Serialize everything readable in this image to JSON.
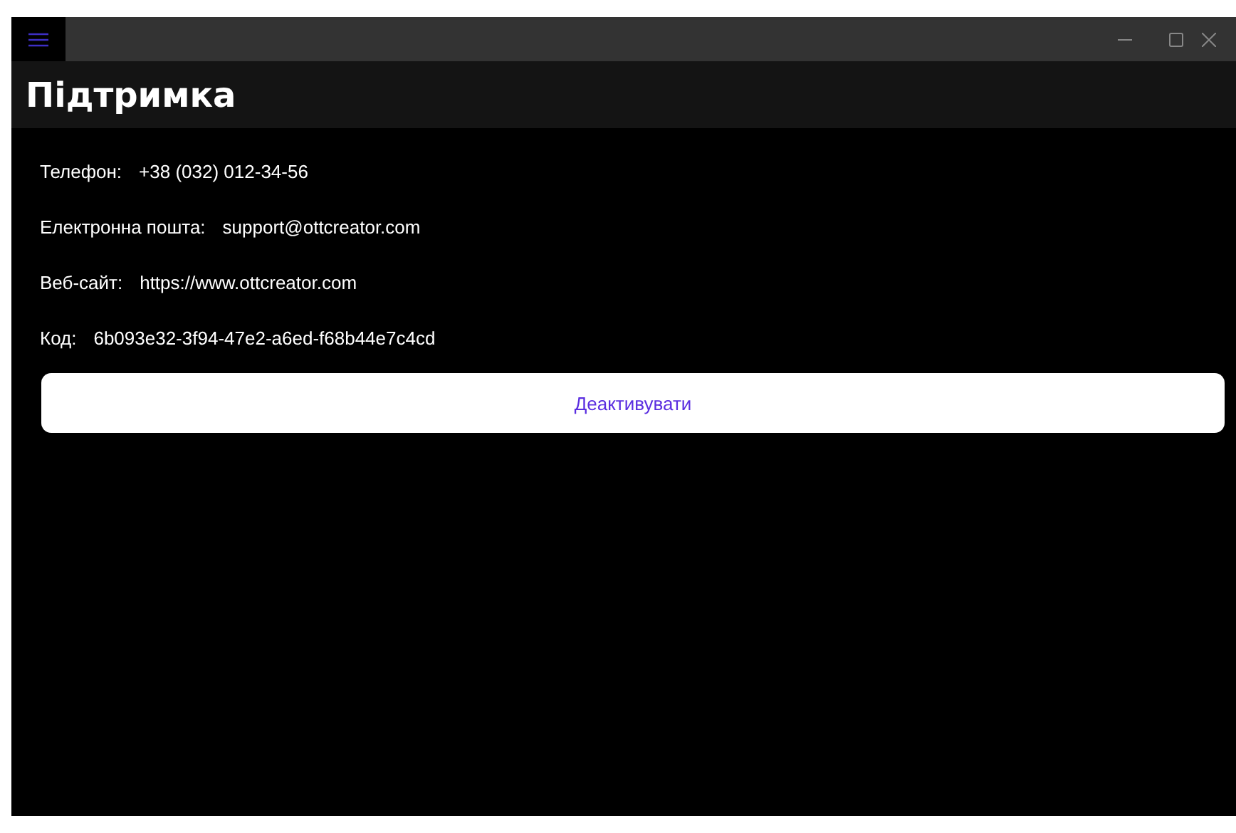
{
  "window": {
    "title": "Підтримка"
  },
  "info": [
    {
      "label": "Телефон:",
      "value": "+38 (032) 012-34-56"
    },
    {
      "label": "Електронна пошта:",
      "value": "support@ottcreator.com"
    },
    {
      "label": "Веб-сайт:",
      "value": "https://www.ottcreator.com"
    },
    {
      "label": "Код:",
      "value": "6b093e32-3f94-47e2-a6ed-f68b44e7c4cd"
    }
  ],
  "buttons": [
    "Деактивувати"
  ]
}
